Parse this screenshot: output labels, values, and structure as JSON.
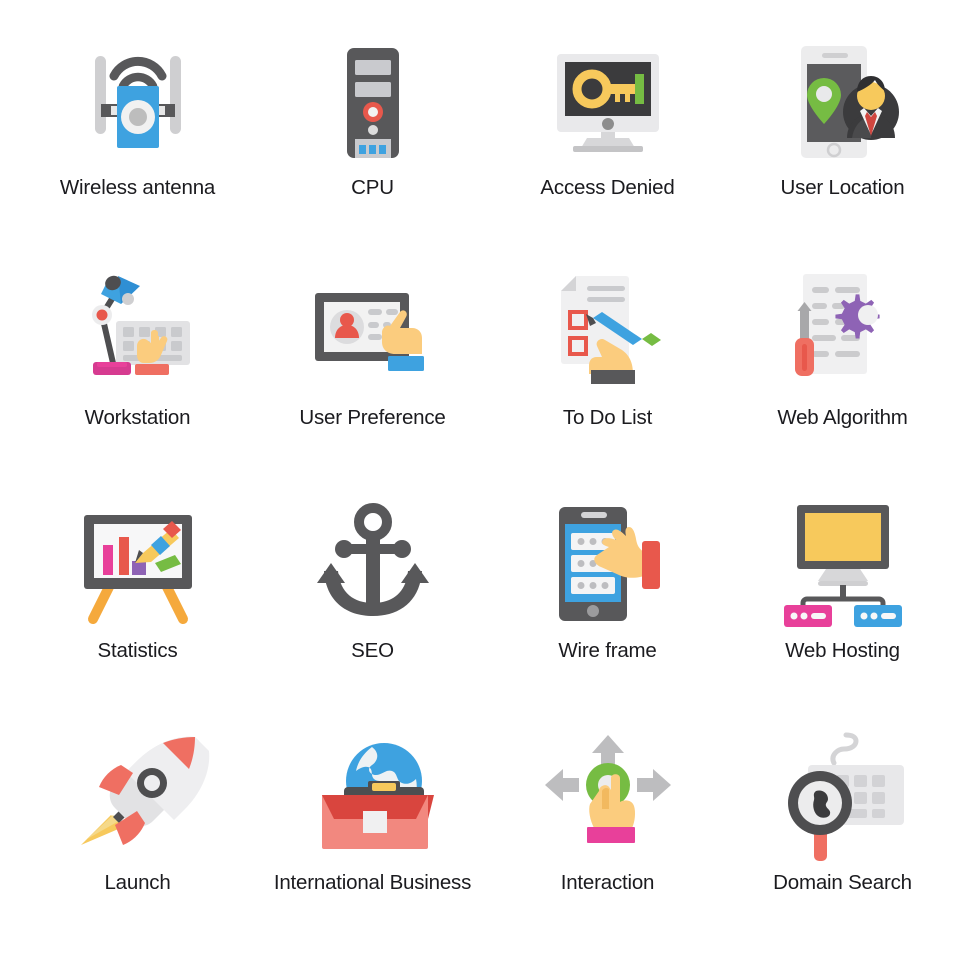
{
  "sheet": {
    "background": "#ffffff",
    "columns": 4,
    "rows": 4,
    "label_color": "#1b1b1f"
  },
  "palette": {
    "gray_dark": "#58585a",
    "gray_medium": "#8d8d8d",
    "gray_light": "#cfcfd1",
    "gray_pale": "#e8e8e8",
    "white": "#f7f7f7",
    "blue": "#3ea2e0",
    "blue_deep": "#2f8fd4",
    "red": "#e8584c",
    "red_soft": "#f2887f",
    "pink": "#e8409a",
    "magenta": "#d63b90",
    "yellow": "#f7c95c",
    "yellow_hand": "#fbcc7e",
    "orange": "#f5a93c",
    "green": "#76bc43",
    "green_dark": "#5aa836",
    "purple": "#8e63b5",
    "dark_screen": "#3b3b3d",
    "coral": "#ef6f62"
  },
  "icons": [
    {
      "id": "wireless-antenna",
      "label": "Wireless antenna",
      "row": 1,
      "col": 1
    },
    {
      "id": "cpu",
      "label": "CPU",
      "row": 1,
      "col": 2
    },
    {
      "id": "access-denied",
      "label": "Access Denied",
      "row": 1,
      "col": 3
    },
    {
      "id": "user-location",
      "label": "User Location",
      "row": 1,
      "col": 4
    },
    {
      "id": "workstation",
      "label": "Workstation",
      "row": 2,
      "col": 1
    },
    {
      "id": "user-preference",
      "label": "User Preference",
      "row": 2,
      "col": 2
    },
    {
      "id": "to-do-list",
      "label": "To Do List",
      "row": 2,
      "col": 3
    },
    {
      "id": "web-algorithm",
      "label": "Web Algorithm",
      "row": 2,
      "col": 4
    },
    {
      "id": "statistics",
      "label": "Statistics",
      "row": 3,
      "col": 1
    },
    {
      "id": "seo",
      "label": "SEO",
      "row": 3,
      "col": 2
    },
    {
      "id": "wire-frame",
      "label": "Wire frame",
      "row": 3,
      "col": 3
    },
    {
      "id": "web-hosting",
      "label": "Web Hosting",
      "row": 3,
      "col": 4
    },
    {
      "id": "launch",
      "label": "Launch",
      "row": 4,
      "col": 1
    },
    {
      "id": "international-business",
      "label": "International Business",
      "row": 4,
      "col": 2
    },
    {
      "id": "interaction",
      "label": "Interaction",
      "row": 4,
      "col": 3
    },
    {
      "id": "domain-search",
      "label": "Domain Search",
      "row": 4,
      "col": 4
    }
  ]
}
